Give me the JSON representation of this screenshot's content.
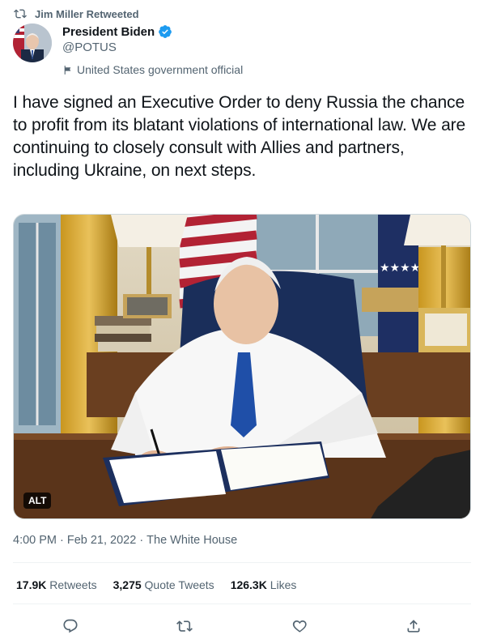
{
  "retweet": {
    "text": "Jim Miller Retweeted",
    "icon": "retweet-icon"
  },
  "author": {
    "name": "President Biden",
    "handle": "@POTUS",
    "verified": true,
    "label": "United States government official",
    "label_icon": "flag-icon"
  },
  "tweet": {
    "text": "I have signed an Executive Order to deny Russia the chance to profit from its blatant violations of international law. We are continuing to closely consult with Allies and partners, including Ukraine, on next steps.",
    "media_alt_badge": "ALT"
  },
  "meta": {
    "time": "4:00 PM",
    "sep1": "·",
    "date": "Feb 21, 2022",
    "sep2": "·",
    "source": "The White House"
  },
  "stats": {
    "retweets_count": "17.9K",
    "retweets_label": "Retweets",
    "quotes_count": "3,275",
    "quotes_label": "Quote Tweets",
    "likes_count": "126.3K",
    "likes_label": "Likes"
  },
  "actions": [
    "reply-icon",
    "retweet-icon",
    "like-icon",
    "share-icon"
  ],
  "colors": {
    "text": "#0f1419",
    "secondary": "#536471",
    "verified": "#1d9bf0",
    "divider": "#eff3f4"
  }
}
